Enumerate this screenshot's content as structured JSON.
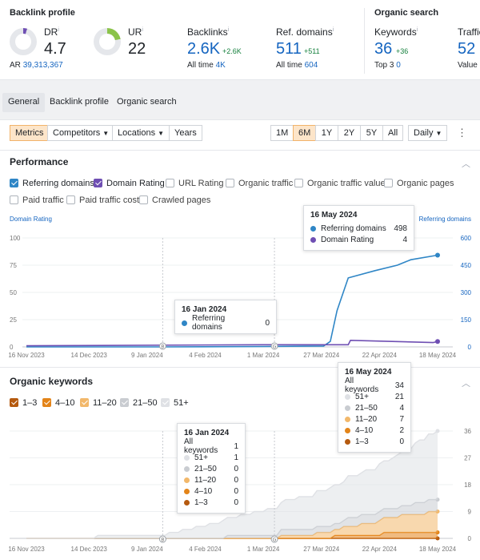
{
  "backlink": {
    "title": "Backlink profile",
    "dr_label": "DR",
    "dr_value": "4.7",
    "dr_fraction": 0.047,
    "ar_label": "AR",
    "ar_value": "39,313,367",
    "ur_label": "UR",
    "ur_value": "22",
    "ur_fraction": 0.22,
    "backlinks_label": "Backlinks",
    "backlinks_value": "2.6K",
    "backlinks_delta": "+2.6K",
    "backlinks_alltime_label": "All time",
    "backlinks_alltime_value": "4K",
    "refdomains_label": "Ref. domains",
    "refdomains_value": "511",
    "refdomains_delta": "+511",
    "refdomains_alltime_label": "All time",
    "refdomains_alltime_value": "604"
  },
  "organic": {
    "title": "Organic search",
    "keywords_label": "Keywords",
    "keywords_value": "36",
    "keywords_delta": "+36",
    "top3_label": "Top 3",
    "top3_value": "0",
    "traffic_label": "Traffic",
    "traffic_value": "52",
    "value_label": "Value"
  },
  "tabs": [
    "General",
    "Backlink profile",
    "Organic search"
  ],
  "toolbar": {
    "metrics": "Metrics",
    "competitors": "Competitors",
    "locations": "Locations",
    "years": "Years",
    "ranges": [
      "1M",
      "6M",
      "1Y",
      "2Y",
      "5Y",
      "All"
    ],
    "active_range": "6M",
    "interval": "Daily"
  },
  "performance": {
    "title": "Performance",
    "checkboxes": [
      {
        "label": "Referring domains",
        "checked": true
      },
      {
        "label": "Domain Rating",
        "checked": true
      },
      {
        "label": "URL Rating",
        "checked": false
      },
      {
        "label": "Organic traffic",
        "checked": false
      },
      {
        "label": "Organic traffic value",
        "checked": false
      },
      {
        "label": "Organic pages",
        "checked": false
      },
      {
        "label": "Paid traffic",
        "checked": false
      },
      {
        "label": "Paid traffic cost",
        "checked": false
      },
      {
        "label": "Crawled pages",
        "checked": false
      }
    ],
    "left_axis_label": "Domain Rating",
    "right_axis_label": "Referring domains",
    "tooltip_a": {
      "date": "16 May 2024",
      "rows": [
        {
          "name": "Referring domains",
          "value": "498",
          "color": "#2f86c6"
        },
        {
          "name": "Domain Rating",
          "value": "4",
          "color": "#6f4fb3"
        }
      ]
    },
    "tooltip_b": {
      "date": "16 Jan 2024",
      "rows": [
        {
          "name": "Referring domains",
          "value": "0",
          "color": "#2f86c6"
        }
      ]
    }
  },
  "keywords_panel": {
    "title": "Organic keywords",
    "legend": [
      {
        "label": "1–3",
        "color": "#b55a0f"
      },
      {
        "label": "4–10",
        "color": "#e38419"
      },
      {
        "label": "11–20",
        "color": "#f2b86b"
      },
      {
        "label": "21–50",
        "color": "#c9ccd1"
      },
      {
        "label": "51+",
        "color": "#dfe1e5"
      }
    ],
    "tooltip_a": {
      "date": "16 May 2024",
      "rows": [
        {
          "name": "All keywords",
          "value": "34",
          "color": ""
        },
        {
          "name": "51+",
          "value": "21",
          "color": "#dfe1e5"
        },
        {
          "name": "21–50",
          "value": "4",
          "color": "#c9ccd1"
        },
        {
          "name": "11–20",
          "value": "7",
          "color": "#f2b86b"
        },
        {
          "name": "4–10",
          "value": "2",
          "color": "#e38419"
        },
        {
          "name": "1–3",
          "value": "0",
          "color": "#b55a0f"
        }
      ]
    },
    "tooltip_b": {
      "date": "16 Jan 2024",
      "rows": [
        {
          "name": "All keywords",
          "value": "1",
          "color": ""
        },
        {
          "name": "51+",
          "value": "1",
          "color": "#dfe1e5"
        },
        {
          "name": "21–50",
          "value": "0",
          "color": "#c9ccd1"
        },
        {
          "name": "11–20",
          "value": "0",
          "color": "#f2b86b"
        },
        {
          "name": "4–10",
          "value": "0",
          "color": "#e38419"
        },
        {
          "name": "1–3",
          "value": "0",
          "color": "#b55a0f"
        }
      ]
    }
  },
  "chart_data": [
    {
      "type": "line",
      "title": "",
      "x_ticks": [
        "16 Nov 2023",
        "14 Dec 2023",
        "9 Jan 2024",
        "4 Feb 2024",
        "1 Mar 2024",
        "27 Mar 2024",
        "22 Apr 2024",
        "18 May 2024"
      ],
      "left_ticks": [
        "100",
        "75",
        "50",
        "25",
        "0"
      ],
      "right_ticks": [
        "600",
        "450",
        "300",
        "150",
        "0"
      ],
      "ylim_left": [
        0,
        100
      ],
      "ylim_right": [
        0,
        600
      ],
      "annotations": [
        "B",
        "G"
      ],
      "series": [
        {
          "name": "Referring domains",
          "axis": "right",
          "color": "#2f86c6",
          "points": [
            [
              "2023-11-16",
              0
            ],
            [
              "2024-01-16",
              0
            ],
            [
              "2024-03-01",
              2
            ],
            [
              "2024-03-28",
              5
            ],
            [
              "2024-03-31",
              30
            ],
            [
              "2024-04-03",
              200
            ],
            [
              "2024-04-08",
              380
            ],
            [
              "2024-04-20",
              420
            ],
            [
              "2024-04-30",
              450
            ],
            [
              "2024-05-06",
              480
            ],
            [
              "2024-05-18",
              505
            ]
          ]
        },
        {
          "name": "Domain Rating",
          "axis": "left",
          "color": "#6f4fb3",
          "points": [
            [
              "2023-11-16",
              1
            ],
            [
              "2024-03-01",
              2
            ],
            [
              "2024-04-08",
              2
            ],
            [
              "2024-04-09",
              6
            ],
            [
              "2024-05-16",
              4
            ],
            [
              "2024-05-18",
              5
            ]
          ]
        }
      ]
    },
    {
      "type": "area",
      "title": "",
      "x_ticks": [
        "16 Nov 2023",
        "14 Dec 2023",
        "9 Jan 2024",
        "4 Feb 2024",
        "1 Mar 2024",
        "27 Mar 2024",
        "22 Apr 2024",
        "18 May 2024"
      ],
      "right_ticks": [
        "36",
        "27",
        "18",
        "9",
        "0"
      ],
      "ylim": [
        0,
        36
      ],
      "annotations": [
        "B",
        "G"
      ],
      "series": [
        {
          "name": "1–3",
          "color": "#b55a0f",
          "points": [
            [
              "2023-11-16",
              0
            ],
            [
              "2024-05-18",
              0
            ]
          ]
        },
        {
          "name": "4–10",
          "color": "#e38419",
          "points": [
            [
              "2023-11-16",
              0
            ],
            [
              "2024-03-20",
              0
            ],
            [
              "2024-04-15",
              1
            ],
            [
              "2024-05-01",
              2
            ],
            [
              "2024-05-18",
              2
            ]
          ]
        },
        {
          "name": "11–20",
          "color": "#f2b86b",
          "points": [
            [
              "2023-11-16",
              0
            ],
            [
              "2024-03-01",
              0
            ],
            [
              "2024-04-01",
              2
            ],
            [
              "2024-04-25",
              5
            ],
            [
              "2024-05-18",
              7
            ]
          ]
        },
        {
          "name": "21–50",
          "color": "#c9ccd1",
          "points": [
            [
              "2023-11-16",
              0
            ],
            [
              "2024-02-01",
              0
            ],
            [
              "2024-03-20",
              2
            ],
            [
              "2024-04-25",
              3
            ],
            [
              "2024-05-18",
              4
            ]
          ]
        },
        {
          "name": "51+",
          "color": "#dfe1e5",
          "points": [
            [
              "2023-11-16",
              0
            ],
            [
              "2024-01-16",
              1
            ],
            [
              "2024-02-15",
              6
            ],
            [
              "2024-03-20",
              11
            ],
            [
              "2024-04-25",
              16
            ],
            [
              "2024-05-18",
              23
            ]
          ]
        }
      ]
    }
  ]
}
